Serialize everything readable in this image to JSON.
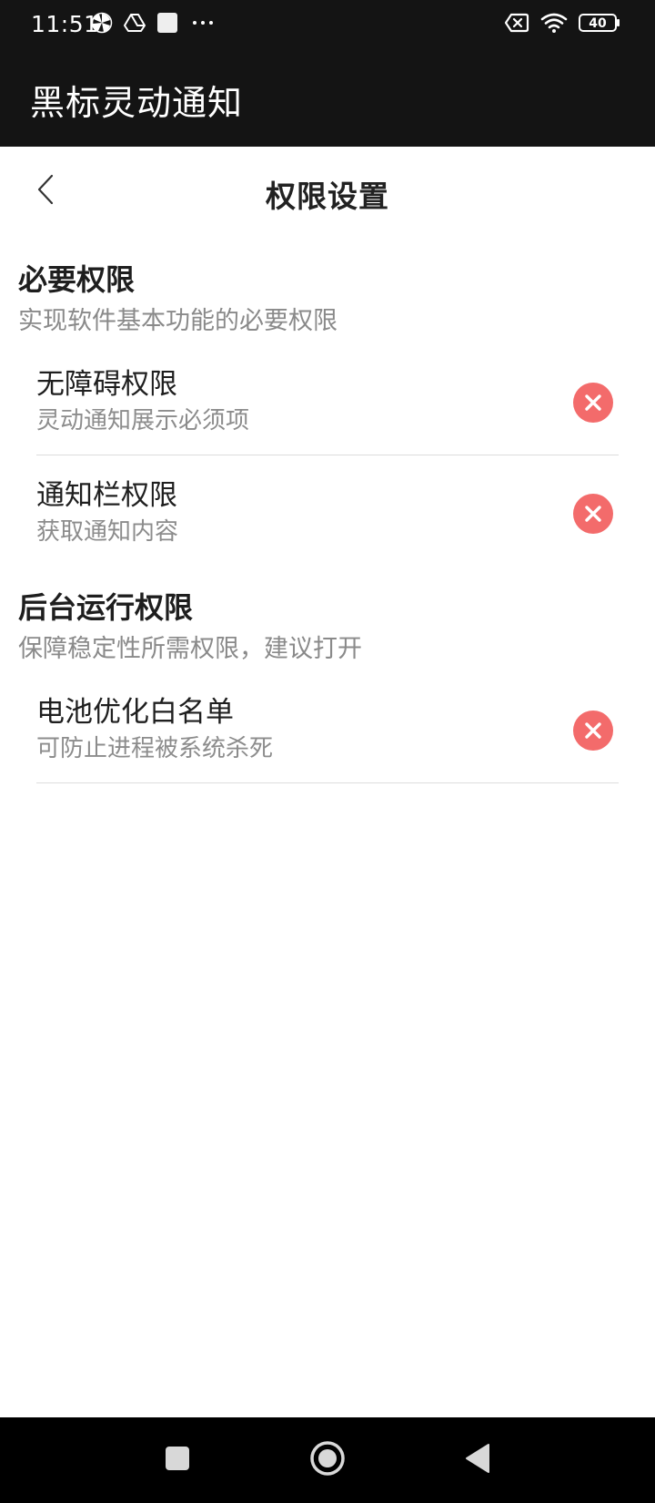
{
  "status_bar": {
    "time": "11:51",
    "battery_level": "40"
  },
  "app_bar": {
    "title": "黑标灵动通知"
  },
  "page": {
    "title": "权限设置"
  },
  "sections": {
    "required": {
      "title": "必要权限",
      "subtitle": "实现软件基本功能的必要权限",
      "items": [
        {
          "title": "无障碍权限",
          "desc": "灵动通知展示必须项",
          "status": "denied"
        },
        {
          "title": "通知栏权限",
          "desc": "获取通知内容",
          "status": "denied"
        }
      ]
    },
    "background": {
      "title": "后台运行权限",
      "subtitle": "保障稳定性所需权限，建议打开",
      "items": [
        {
          "title": "电池优化白名单",
          "desc": "可防止进程被系统杀死",
          "status": "denied"
        }
      ]
    }
  },
  "colors": {
    "denied": "#f36b6b",
    "bar_bg": "#141414",
    "nav_bg": "#000000"
  },
  "icons": {
    "status_denied": "close-circle-icon",
    "back": "chevron-left-icon"
  }
}
